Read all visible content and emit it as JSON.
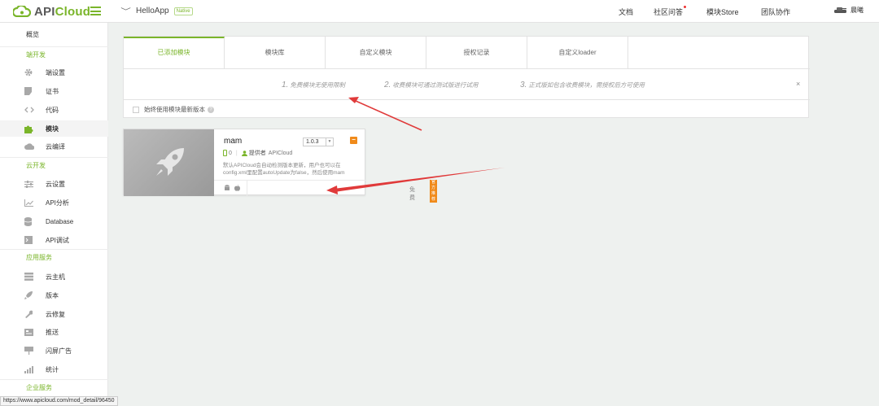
{
  "topbar": {
    "logo_api": "API",
    "logo_cloud": "Cloud",
    "app_name": "HelloApp",
    "app_badge": "Native",
    "nav": [
      "文档",
      "社区问答",
      "模块Store",
      "团队协作"
    ],
    "user_name": "晨曦"
  },
  "sidebar": {
    "overview": "概览",
    "sections": [
      {
        "title": "端开发",
        "items": [
          {
            "label": "端设置",
            "icon": "gear-icon"
          },
          {
            "label": "证书",
            "icon": "certificate-icon"
          },
          {
            "label": "代码",
            "icon": "code-icon"
          },
          {
            "label": "模块",
            "icon": "puzzle-icon",
            "active": true
          },
          {
            "label": "云编译",
            "icon": "cloud-icon"
          }
        ]
      },
      {
        "title": "云开发",
        "items": [
          {
            "label": "云设置",
            "icon": "sliders-icon"
          },
          {
            "label": "API分析",
            "icon": "chart-icon"
          },
          {
            "label": "Database",
            "icon": "database-icon"
          },
          {
            "label": "API调试",
            "icon": "debug-icon"
          }
        ]
      },
      {
        "title": "应用服务",
        "items": [
          {
            "label": "云主机",
            "icon": "server-icon"
          },
          {
            "label": "版本",
            "icon": "rocket-icon"
          },
          {
            "label": "云修复",
            "icon": "wrench-icon"
          },
          {
            "label": "推送",
            "icon": "push-icon"
          },
          {
            "label": "闪屏广告",
            "icon": "billboard-icon"
          },
          {
            "label": "统计",
            "icon": "stats-icon"
          }
        ]
      },
      {
        "title": "企业服务",
        "items": []
      }
    ]
  },
  "tabs": [
    "已添加模块",
    "模块库",
    "自定义模块",
    "授权记录",
    "自定义loader"
  ],
  "steps": [
    {
      "n": "1.",
      "text": "免费模块无使用限制"
    },
    {
      "n": "2.",
      "text": "收费模块可通过测试版进行试用"
    },
    {
      "n": "3.",
      "text": "正式版如包含收费模块，需授权后方可使用"
    }
  ],
  "close": "×",
  "option": {
    "label": "始终使用模块最新版本",
    "help": "?"
  },
  "module": {
    "name": "mam",
    "version": "1.0.3",
    "count": "0",
    "provider_label": "提供者",
    "provider": "APICloud",
    "description": "默认APICloud会自动检测版本更新，用户也可以在config.xml里配置autoUpdate为false，然后使用mam",
    "price": "免费",
    "tag": "官方推荐",
    "minus": "−"
  },
  "statusbar": {
    "url": "https://www.apicloud.com/mod_detail/96450"
  },
  "colors": {
    "accent": "#7ab52a",
    "orange": "#f08a1a",
    "arrow": "#e03a3a"
  }
}
